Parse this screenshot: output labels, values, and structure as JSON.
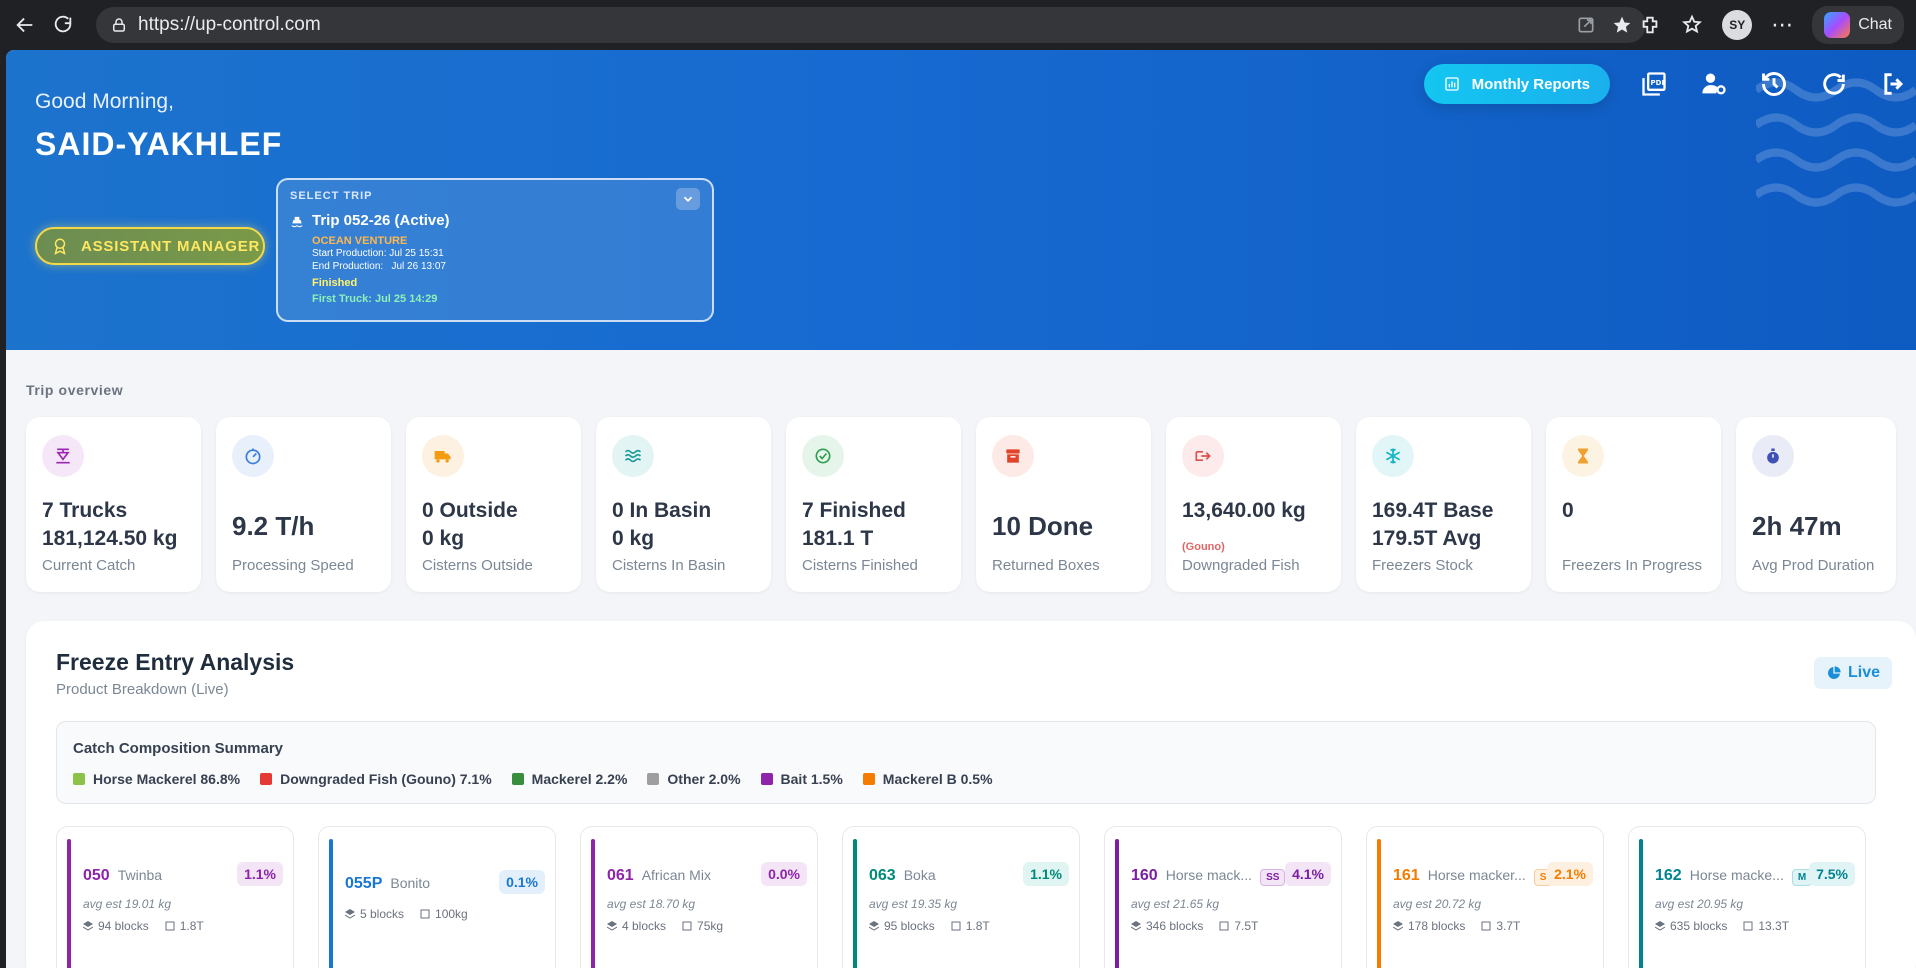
{
  "browser": {
    "url": "https://up-control.com",
    "profile_initials": "SY",
    "chat_label": "Chat"
  },
  "header": {
    "greeting": "Good Morning,",
    "username": "SAID-YAKHLEF",
    "role": "ASSISTANT MANAGER",
    "monthly_reports_label": "Monthly Reports"
  },
  "trip": {
    "select_label": "SELECT TRIP",
    "title": "Trip 052-26 (Active)",
    "vessel": "OCEAN VENTURE",
    "start": "Start Production: Jul 25 15:31",
    "end": "End Production:   Jul 26 13:07",
    "status": "Finished",
    "first_truck": "First Truck: Jul 25 14:29"
  },
  "overview": {
    "section_label": "Trip overview",
    "cards": [
      {
        "line1": "7 Trucks",
        "line2": "181,124.50 kg",
        "label": "Current Catch",
        "icon": "scale-icon",
        "color": "#9c27b0",
        "bg": "#f5e6f8"
      },
      {
        "big": "9.2 T/h",
        "label": "Processing Speed",
        "icon": "speedometer-icon",
        "color": "#3b7ddd",
        "bg": "#e8f0fb"
      },
      {
        "line1": "0 Outside",
        "line2": "0 kg",
        "label": "Cisterns Outside",
        "icon": "truck-icon",
        "color": "#f39c12",
        "bg": "#fdf1e1"
      },
      {
        "line1": "0 In Basin",
        "line2": "0 kg",
        "label": "Cisterns In Basin",
        "icon": "water-icon",
        "color": "#1b9c9c",
        "bg": "#e2f4f3"
      },
      {
        "line1": "7 Finished",
        "line2": "181.1 T",
        "label": "Cisterns Finished",
        "icon": "check-circle-icon",
        "color": "#2e9e4f",
        "bg": "#e6f5ea"
      },
      {
        "big": "10 Done",
        "label": "Returned Boxes",
        "icon": "box-icon",
        "color": "#e0452b",
        "bg": "#fdeae6"
      },
      {
        "line1": "13,640.00 kg",
        "sub": "(Gouno)",
        "label": "Downgraded Fish",
        "icon": "fish-icon",
        "color": "#e04e4e",
        "bg": "#fdeaea"
      },
      {
        "line1": "169.4T Base",
        "line2": "179.5T Avg",
        "label": "Freezers Stock",
        "icon": "snowflake-icon",
        "color": "#12b5c6",
        "bg": "#e2f6f8"
      },
      {
        "line1": "0",
        "label": "Freezers In Progress",
        "icon": "hourglass-icon",
        "color": "#f0a030",
        "bg": "#fdf3e3"
      },
      {
        "big": "2h 47m",
        "label": "Avg Prod Duration",
        "icon": "stopwatch-icon",
        "color": "#3f51b5",
        "bg": "#e9ebf7"
      }
    ]
  },
  "freeze": {
    "title": "Freeze Entry Analysis",
    "subtitle": "Product Breakdown (Live)",
    "live_label": "Live",
    "summary_title": "Catch Composition Summary",
    "legend": [
      {
        "label": "Horse Mackerel 86.8%",
        "color": "#8bc34a"
      },
      {
        "label": "Downgraded Fish (Gouno) 7.1%",
        "color": "#e53935"
      },
      {
        "label": "Mackerel 2.2%",
        "color": "#388e3c"
      },
      {
        "label": "Other 2.0%",
        "color": "#9e9e9e"
      },
      {
        "label": "Bait 1.5%",
        "color": "#8e24aa"
      },
      {
        "label": "Mackerel B 0.5%",
        "color": "#f57c00"
      }
    ],
    "products": [
      {
        "code": "050",
        "name": "Twinba",
        "size": "",
        "pct": "1.1%",
        "avg": "avg est 19.01 kg",
        "blocks": "94 blocks",
        "weight": "1.8T",
        "color": "#8e24aa",
        "pct_bg": "#f3e5f5"
      },
      {
        "code": "055P",
        "name": "Bonito",
        "size": "",
        "pct": "0.1%",
        "avg": "",
        "blocks": "5 blocks",
        "weight": "100kg",
        "color": "#1976d2",
        "pct_bg": "#e3f0fb"
      },
      {
        "code": "061",
        "name": "African Mix",
        "size": "",
        "pct": "0.0%",
        "avg": "avg est 18.70 kg",
        "blocks": "4 blocks",
        "weight": "75kg",
        "color": "#8e24aa",
        "pct_bg": "#f3e5f5"
      },
      {
        "code": "063",
        "name": "Boka",
        "size": "",
        "pct": "1.1%",
        "avg": "avg est 19.35 kg",
        "blocks": "95 blocks",
        "weight": "1.8T",
        "color": "#00897b",
        "pct_bg": "#e0f4f2"
      },
      {
        "code": "160",
        "name": "Horse mack...",
        "size": "SS",
        "pct": "4.1%",
        "avg": "avg est 21.65 kg",
        "blocks": "346 blocks",
        "weight": "7.5T",
        "color": "#7b1fa2",
        "pct_bg": "#f3e5f5"
      },
      {
        "code": "161",
        "name": "Horse macker...",
        "size": "S",
        "pct": "2.1%",
        "avg": "avg est 20.72 kg",
        "blocks": "178 blocks",
        "weight": "3.7T",
        "color": "#f57c00",
        "pct_bg": "#fdf0e0"
      },
      {
        "code": "162",
        "name": "Horse macke...",
        "size": "M",
        "pct": "7.5%",
        "avg": "avg est 20.95 kg",
        "blocks": "635 blocks",
        "weight": "13.3T",
        "color": "#00838f",
        "pct_bg": "#e0f4f6"
      }
    ]
  }
}
